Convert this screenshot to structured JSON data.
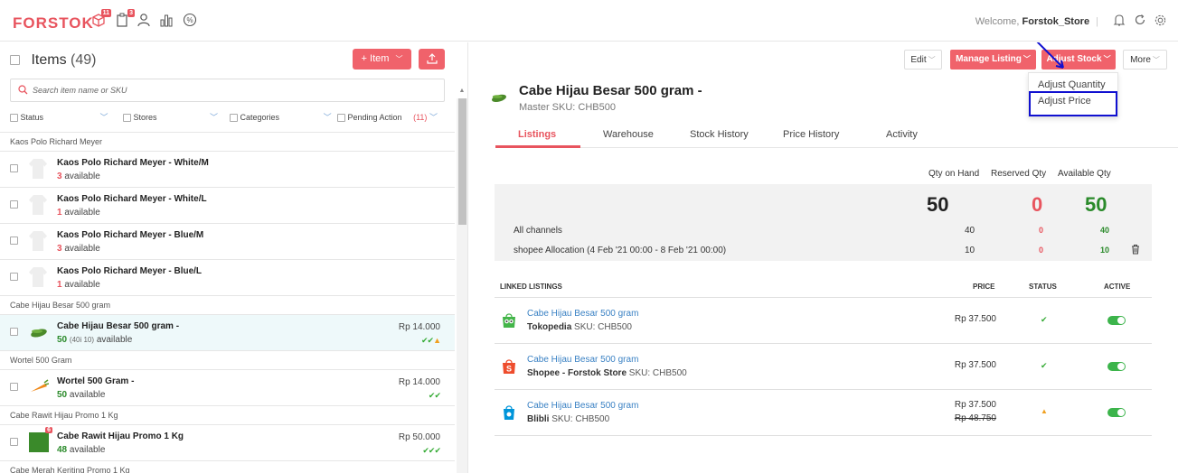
{
  "topbar": {
    "logo": "FORSTOK",
    "badges": {
      "box": "11",
      "clipboard": "3"
    },
    "welcome_prefix": "Welcome,",
    "store_name": "Forstok_Store",
    "separator": "|"
  },
  "left": {
    "items_label": "Items",
    "items_count": "(49)",
    "add_item_label": "+ Item",
    "search_placeholder": "Search item name or SKU",
    "filters": {
      "status": "Status",
      "stores": "Stores",
      "categories": "Categories",
      "pending": "Pending Action",
      "pending_count": "(11)"
    },
    "groups": {
      "g1": "Kaos Polo Richard Meyer",
      "g2": "Cabe Hijau Besar 500 gram",
      "g3": "Wortel 500 Gram",
      "g4": "Cabe Rawit Hijau Promo 1 Kg",
      "g5": "Cabe Merah Keriting Promo 1 Kg"
    },
    "rows": [
      {
        "name": "Kaos Polo Richard Meyer - White/M",
        "qty": "3",
        "avail": "available"
      },
      {
        "name": "Kaos Polo Richard Meyer - White/L",
        "qty": "1",
        "avail": "available"
      },
      {
        "name": "Kaos Polo Richard Meyer - Blue/M",
        "qty": "3",
        "avail": "available"
      },
      {
        "name": "Kaos Polo Richard Meyer - Blue/L",
        "qty": "1",
        "avail": "available"
      },
      {
        "name": "Cabe Hijau Besar 500 gram -",
        "qty": "50",
        "detail": "(40i 10)",
        "avail": "available",
        "price": "Rp 14.000",
        "status": "✔✔"
      },
      {
        "name": "Wortel 500 Gram -",
        "qty": "50",
        "avail": "available",
        "price": "Rp 14.000",
        "status": "✔✔"
      },
      {
        "name": "Cabe Rawit Hijau Promo 1 Kg",
        "qty": "48",
        "avail": "available",
        "price": "Rp 50.000",
        "status": "✔✔✔",
        "badge": "6"
      }
    ]
  },
  "right": {
    "buttons": {
      "edit": "Edit",
      "manage": "Manage Listing",
      "adjust": "Adjust Stock",
      "more": "More"
    },
    "dropdown": {
      "adjust_quantity": "Adjust Quantity",
      "adjust_price": "Adjust Price"
    },
    "product": {
      "name": "Cabe Hijau Besar 500 gram -",
      "sku": "Master SKU: CHB500"
    },
    "tabs": [
      "Listings",
      "Warehouse",
      "Stock History",
      "Price History",
      "Activity"
    ],
    "qty_headers": {
      "on_hand": "Qty on Hand",
      "reserved": "Reserved Qty",
      "available": "Available Qty"
    },
    "qty_totals": {
      "on_hand": "50",
      "reserved": "0",
      "available": "50"
    },
    "qty_rows": [
      {
        "label": "All channels",
        "on_hand": "40",
        "reserved": "0",
        "available": "40"
      },
      {
        "label": "shopee Allocation (4 Feb '21 00:00 - 8 Feb '21 00:00)",
        "on_hand": "10",
        "reserved": "0",
        "available": "10"
      }
    ],
    "linked_headers": {
      "listings": "LINKED LISTINGS",
      "price": "PRICE",
      "status": "STATUS",
      "active": "ACTIVE"
    },
    "linked": [
      {
        "name": "Cabe Hijau Besar 500 gram",
        "channel": "Tokopedia",
        "sku": "SKU: CHB500",
        "price": "Rp  37.500",
        "status": "✔"
      },
      {
        "name": "Cabe Hijau Besar 500 gram",
        "channel": "Shopee - Forstok Store",
        "sku": "SKU: CHB500",
        "price": "Rp  37.500",
        "status": "✔"
      },
      {
        "name": "Cabe Hijau Besar 500 gram",
        "channel": "Blibli",
        "sku": "SKU: CHB500",
        "price": "Rp 37.500",
        "old_price": "Rp  48.750",
        "status": "▲"
      }
    ]
  },
  "colors": {
    "brand": "#e8545e",
    "green": "#2a8a2a",
    "annotation": "#1010d0"
  }
}
